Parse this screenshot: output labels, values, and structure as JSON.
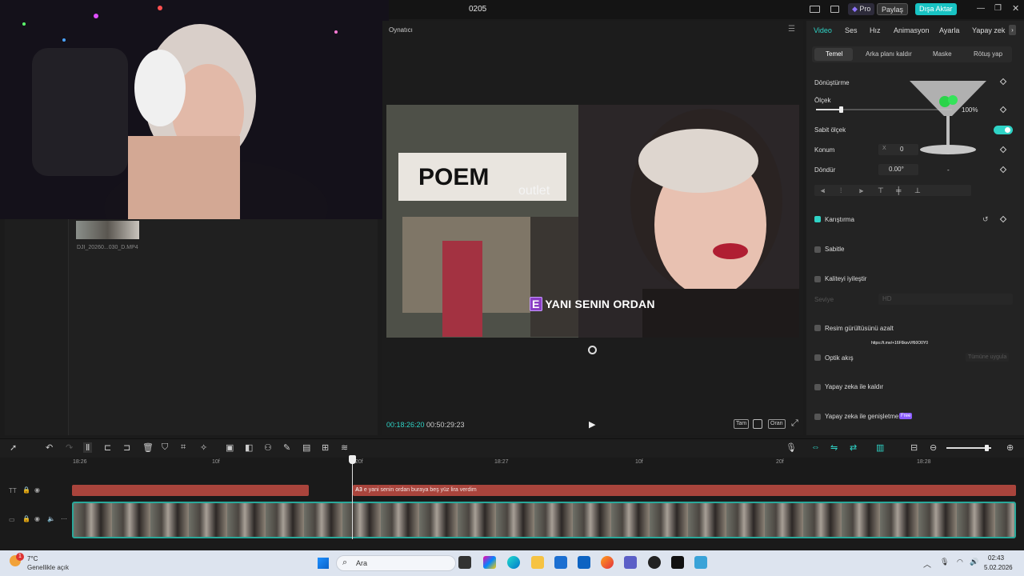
{
  "app": {
    "title": "0205"
  },
  "titlebar": {
    "pro": "Pro",
    "share": "Paylaş",
    "export": "Dışa Aktar"
  },
  "player": {
    "title": "Oynatıcı",
    "subtitle_letter": "E",
    "subtitle_text": "YANI SENIN ORDAN",
    "time_current": "00:18:26:20",
    "time_total": "00:50:29:23",
    "btn_full": "Tam",
    "btn_ratio": "Oran"
  },
  "media": {
    "clip_name": "DJI_20260...030_D.MP4"
  },
  "props": {
    "tabs": [
      "Video",
      "Ses",
      "Hız",
      "Animasyon",
      "Ayarla",
      "Yapay zek"
    ],
    "subtabs": [
      "Temel",
      "Arka planı kaldır",
      "Maske",
      "Rötuş yap"
    ],
    "transform": "Dönüştürme",
    "scale": "Ölçek",
    "scale_value": "100%",
    "uniform_scale": "Sabit ölçek",
    "position": "Konum",
    "pos_x_label": "X",
    "pos_x": "0",
    "rotate": "Döndür",
    "rotate_value": "0.00°",
    "rotate_dash": "-",
    "blend": "Karıştırma",
    "stabilize": "Sabitle",
    "enhance": "Kaliteyi iyileştir",
    "level": "Seviye",
    "level_value": "HD",
    "denoise": "Resim gürültüsünü azalt",
    "overlay_link": "https://t.me/+16F6ksvVf60O0Y0",
    "optical": "Optik akış",
    "apply_all": "Tümüne uygula",
    "ai_remove": "Yapay zeka ile kaldır",
    "ai_expand": "Yapay zeka ile genişletme",
    "free_badge": "Free"
  },
  "timeline": {
    "ruler": [
      "18:26",
      "10f",
      "20f",
      "18:27",
      "10f",
      "20f",
      "18:28"
    ],
    "text_clip": "e yani senin ordan buraya beş yüz lira verdim",
    "text_clip_prefix": "A3"
  },
  "taskbar": {
    "temp": "7°C",
    "weather": "Genellikle açık",
    "search": "Ara",
    "time": "02:43",
    "date": "5.02.2026",
    "notification_count": "1"
  },
  "colors": {
    "accent": "#2fd3c6",
    "clip_red": "#a9443c",
    "track_teal": "#2aa89a",
    "pro_purple": "#7b5cff"
  }
}
